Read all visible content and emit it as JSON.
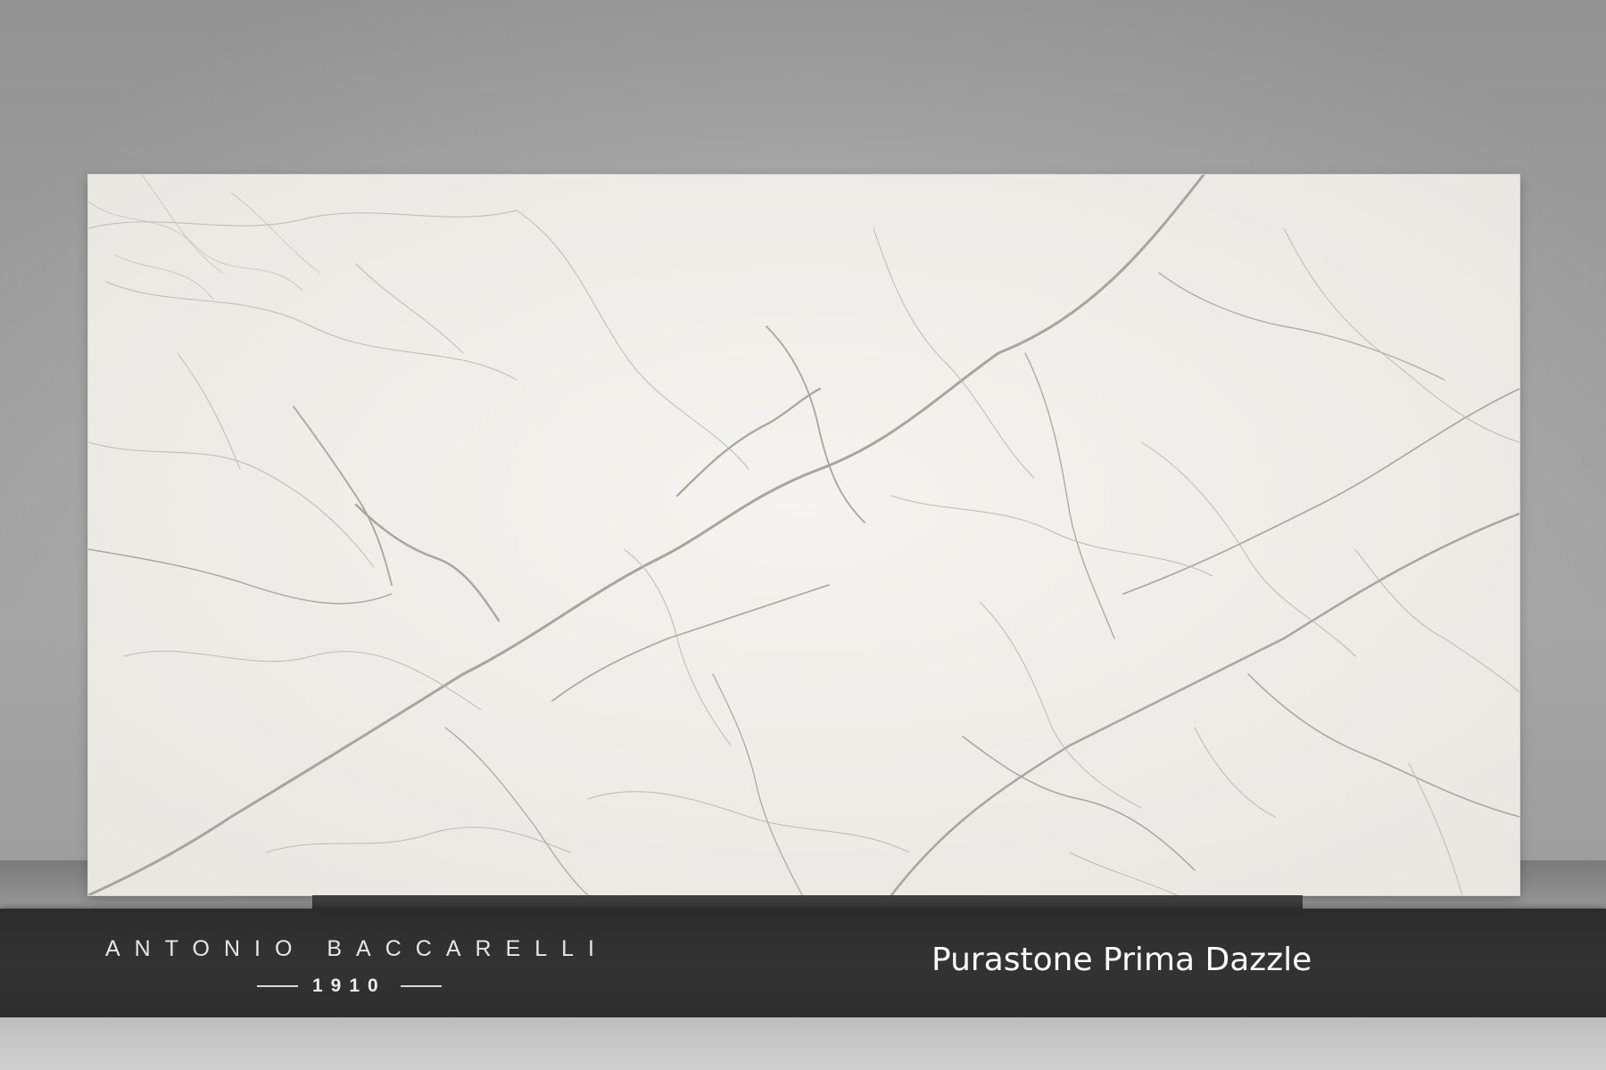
{
  "brand": {
    "name": "ANTONIO BACCARELLI",
    "year": "1910"
  },
  "product": {
    "title": "Purastone Prima Dazzle"
  },
  "colors": {
    "wall": "#a9a9a9",
    "slab": "#f0eeea",
    "vein": "#8f8c86",
    "banner": "#303030",
    "text": "#ffffff"
  }
}
